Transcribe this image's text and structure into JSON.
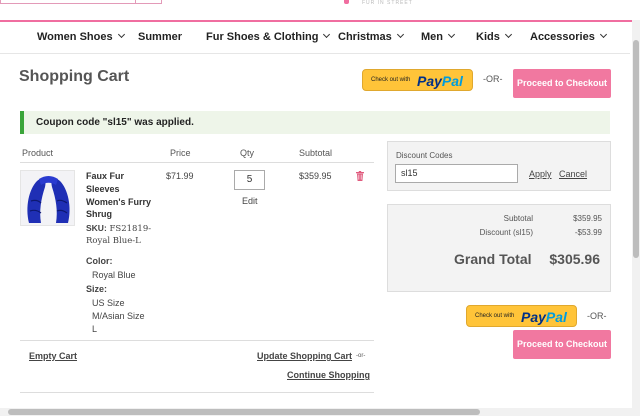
{
  "header": {
    "logo_text": "FUR IN STREET"
  },
  "nav": {
    "items": [
      {
        "label": "Women Shoes"
      },
      {
        "label": "Summer"
      },
      {
        "label": "Fur Shoes & Clothing"
      },
      {
        "label": "Christmas"
      },
      {
        "label": "Men"
      },
      {
        "label": "Kids"
      },
      {
        "label": "Accessories"
      }
    ]
  },
  "cart": {
    "title": "Shopping Cart",
    "paypal": {
      "check_out_with": "Check out with",
      "brand_pay": "Pay",
      "brand_pal": "Pal"
    },
    "or_label": "-OR-",
    "proceed_label": "Proceed to Checkout",
    "coupon_message": "Coupon code \"sl15\" was applied.",
    "columns": {
      "product": "Product",
      "price": "Price",
      "qty": "Qty",
      "subtotal": "Subtotal"
    },
    "item": {
      "name": "Faux Fur Sleeves Women's Furry Shrug",
      "sku_label": "SKU:",
      "sku": "FS21819-Royal Blue-L",
      "color_label": "Color:",
      "color_value": "Royal Blue",
      "size_label": "Size:",
      "size_value_1": "US Size",
      "size_value_2": "M/Asian Size",
      "size_value_3": "L",
      "price": "$71.99",
      "qty": "5",
      "edit_label": "Edit",
      "subtotal": "$359.95"
    },
    "actions": {
      "empty_cart": "Empty Cart",
      "update_cart": "Update Shopping Cart",
      "or_small": "-or-",
      "continue": "Continue Shopping"
    }
  },
  "discount": {
    "label": "Discount Codes",
    "value": "sl15",
    "apply": "Apply",
    "cancel": "Cancel"
  },
  "totals": {
    "subtotal_label": "Subtotal",
    "subtotal_value": "$359.95",
    "discount_label": "Discount (sl15)",
    "discount_value": "-$53.99",
    "grand_label": "Grand Total",
    "grand_value": "$305.96"
  },
  "colors": {
    "accent": "#f178a0",
    "paypal": "#ffc439",
    "success": "#3aa53a"
  }
}
